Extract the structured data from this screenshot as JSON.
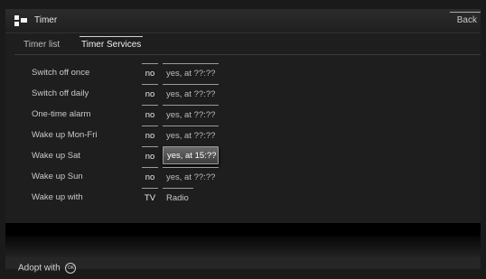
{
  "window": {
    "title": "Timer",
    "back_label": "Back"
  },
  "tabs": [
    {
      "label": "Timer list",
      "active": false
    },
    {
      "label": "Timer Services",
      "active": true
    }
  ],
  "rows": [
    {
      "label": "Switch off once",
      "opt_no": "no",
      "opt_yes": "yes, at ??:??",
      "selected": null
    },
    {
      "label": "Switch off daily",
      "opt_no": "no",
      "opt_yes": "yes, at ??:??",
      "selected": null
    },
    {
      "label": "One-time alarm",
      "opt_no": "no",
      "opt_yes": "yes, at ??:??",
      "selected": null
    },
    {
      "label": "Wake up Mon-Fri",
      "opt_no": "no",
      "opt_yes": "yes, at ??:??",
      "selected": null
    },
    {
      "label": "Wake up Sat",
      "opt_no": "no",
      "opt_yes": "yes, at 15:??",
      "selected": "yes"
    },
    {
      "label": "Wake up Sun",
      "opt_no": "no",
      "opt_yes": "yes, at ??:??",
      "selected": null
    },
    {
      "label": "Wake up with",
      "opt_tv": "TV",
      "opt_radio": "Radio",
      "selected": null
    }
  ],
  "footer": {
    "adopt_label": "Adopt with",
    "ok_icon_glyph": "OK"
  },
  "icons": {
    "app": "timer-app-icon",
    "ok": "ok-button-icon"
  }
}
